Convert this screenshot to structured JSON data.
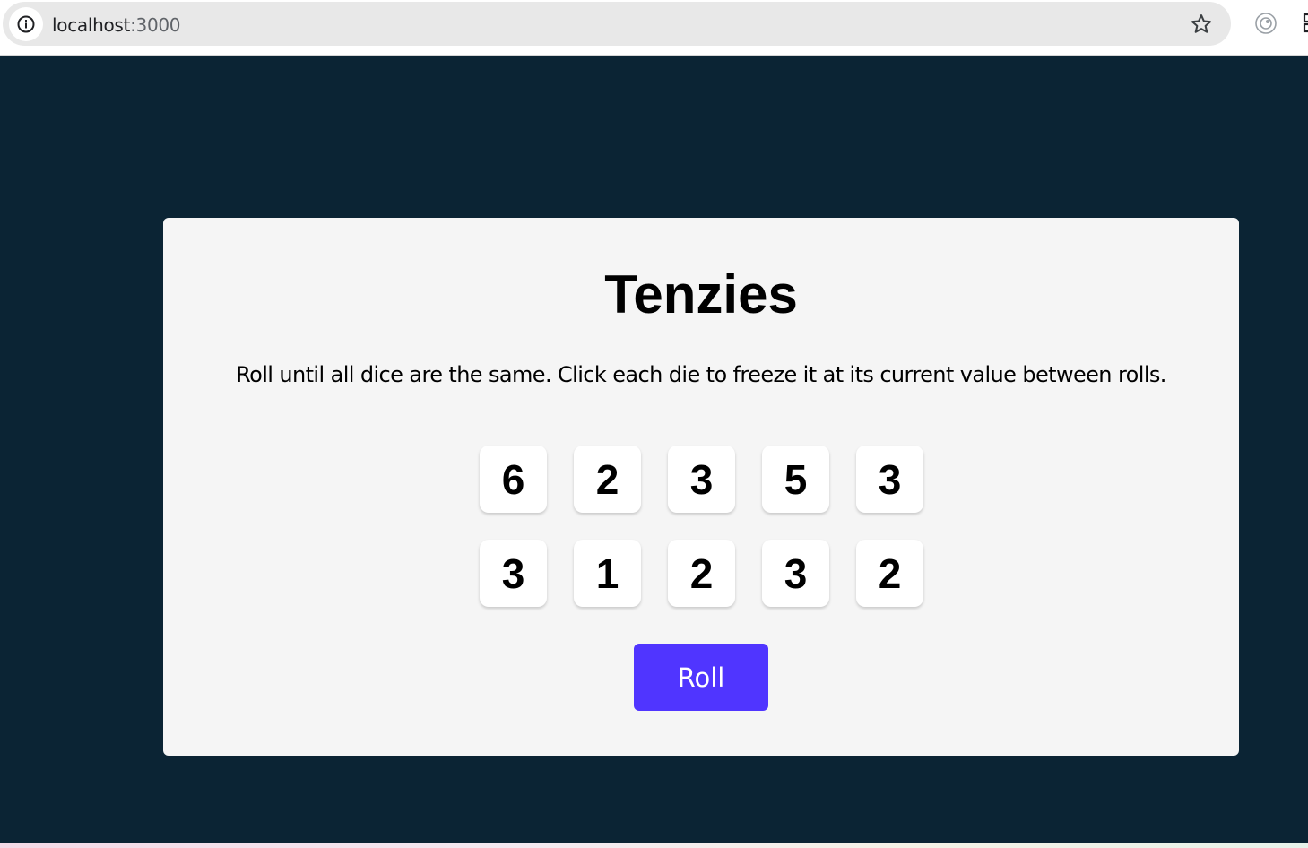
{
  "browser": {
    "url_host": "localhost",
    "url_port": ":3000",
    "icons": [
      "info-icon",
      "star-icon",
      "extension-icon",
      "puzzle-icon"
    ]
  },
  "app": {
    "title": "Tenzies",
    "instructions": "Roll until all dice are the same. Click each die to freeze it at its current value between rolls.",
    "dice": [
      "6",
      "2",
      "3",
      "5",
      "3",
      "3",
      "1",
      "2",
      "3",
      "2"
    ],
    "roll_label": "Roll"
  },
  "colors": {
    "page_background": "#0b2434",
    "card_background": "#f5f5f5",
    "roll_button": "#5035ff",
    "die_face": "#ffffff"
  }
}
